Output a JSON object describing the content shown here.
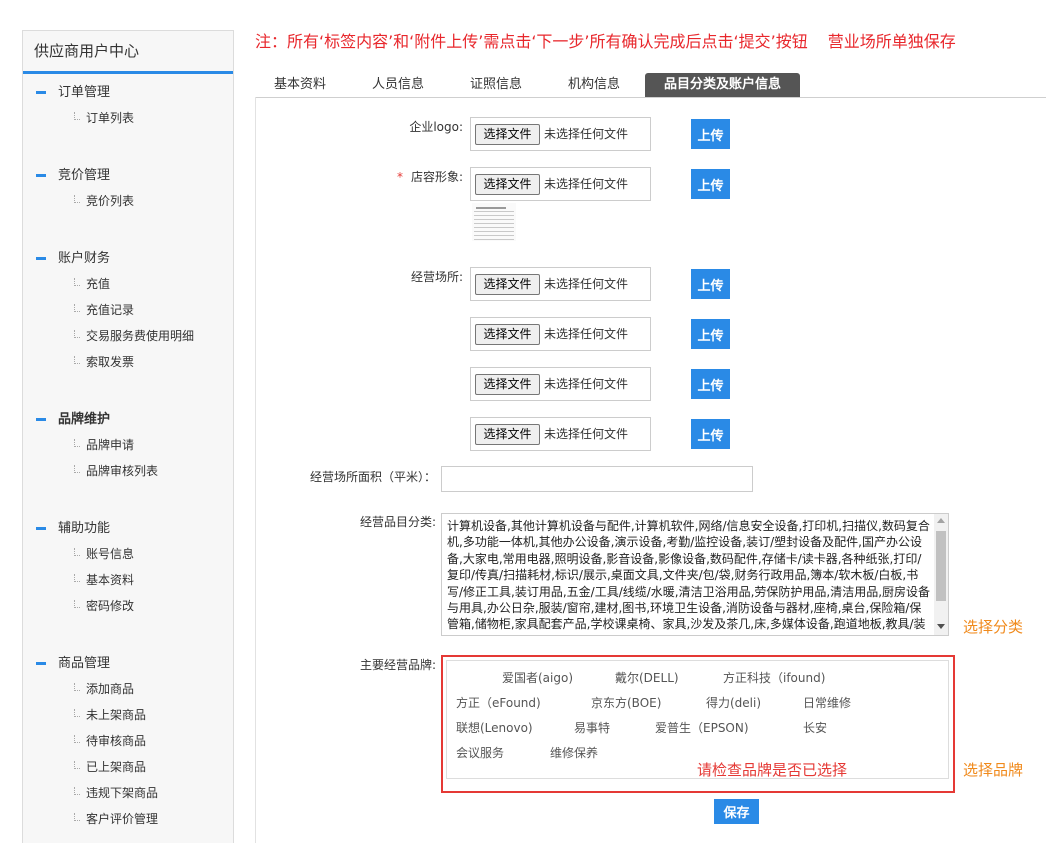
{
  "colors": {
    "accent": "#2a8ae6",
    "notice_red": "#e8272c",
    "hint_orange": "#f08a1c",
    "active_tab_bg": "#555555",
    "warning_red": "#e53935"
  },
  "sidebar": {
    "title": "供应商用户中心",
    "groups": [
      {
        "label": "订单管理",
        "emphasized": false,
        "items": [
          "订单列表"
        ]
      },
      {
        "label": "竞价管理",
        "emphasized": false,
        "items": [
          "竞价列表"
        ]
      },
      {
        "label": "账户财务",
        "emphasized": false,
        "items": [
          "充值",
          "充值记录",
          "交易服务费使用明细",
          "索取发票"
        ]
      },
      {
        "label": "品牌维护",
        "emphasized": true,
        "items": [
          "品牌申请",
          "品牌审核列表"
        ]
      },
      {
        "label": "辅助功能",
        "emphasized": false,
        "items": [
          "账号信息",
          "基本资料",
          "密码修改"
        ]
      },
      {
        "label": "商品管理",
        "emphasized": false,
        "items": [
          "添加商品",
          "未上架商品",
          "待审核商品",
          "已上架商品",
          "违规下架商品",
          "客户评价管理"
        ]
      }
    ]
  },
  "notice": {
    "main": "注：所有‘标签内容’和‘附件上传’需点击‘下一步’所有确认完成后点击‘提交’按钮",
    "extra": "营业场所单独保存"
  },
  "tabs": [
    {
      "label": "基本资料",
      "active": false
    },
    {
      "label": "人员信息",
      "active": false
    },
    {
      "label": "证照信息",
      "active": false
    },
    {
      "label": "机构信息",
      "active": false
    },
    {
      "label": "品目分类及账户信息",
      "active": true
    }
  ],
  "form": {
    "logo": {
      "label": "企业logo:",
      "file": {
        "button": "选择文件",
        "status": "未选择任何文件"
      },
      "upload": "上传"
    },
    "storefront": {
      "required_mark": "*",
      "label": "店容形象:",
      "file": {
        "button": "选择文件",
        "status": "未选择任何文件"
      },
      "upload": "上传"
    },
    "premises": {
      "label": "经营场所:",
      "files": [
        {
          "button": "选择文件",
          "status": "未选择任何文件",
          "upload": "上传"
        },
        {
          "button": "选择文件",
          "status": "未选择任何文件",
          "upload": "上传"
        },
        {
          "button": "选择文件",
          "status": "未选择任何文件",
          "upload": "上传"
        },
        {
          "button": "选择文件",
          "status": "未选择任何文件",
          "upload": "上传"
        }
      ]
    },
    "area": {
      "label": "经营场所面积（平米）：",
      "value": ""
    },
    "categories": {
      "label": "经营品目分类:",
      "value": "计算机设备,其他计算机设备与配件,计算机软件,网络/信息安全设备,打印机,扫描仪,数码复合机,多功能一体机,其他办公设备,演示设备,考勤/监控设备,装订/塑封设备及配件,国产办公设备,大家电,常用电器,照明设备,影音设备,影像设备,数码配件,存储卡/读卡器,各种纸张,打印/复印/传真/扫描耗材,标识/展示,桌面文具,文件夹/包/袋,财务行政用品,簿本/软木板/白板,书写/修正工具,装订用品,五金/工具/线缆/水暖,清洁卫浴用品,劳保防护用品,清洁用品,厨房设备与用具,办公日杂,服装/窗帘,建材,图书,环境卫生设备,消防设备与器材,座椅,桌台,保险箱/保管箱,储物柜,家具配套产品,学校课桌椅、家具,沙发及茶几,床,多媒体设备,跑道地板,教具/装具,",
      "hint": "选择分类"
    },
    "brands": {
      "label": "主要经营品牌:",
      "rows": [
        [
          "爱国者(aigo)",
          "戴尔(DELL)",
          "方正科技（ifound)"
        ],
        [
          "方正（eFound)",
          "京东方(BOE)",
          "得力(deli)",
          "日常维修"
        ],
        [
          "联想(Lenovo)",
          "易事特",
          "爱普生（EPSON)",
          "长安"
        ],
        [
          "会议服务",
          "维修保养"
        ]
      ],
      "warning": "请检查品牌是否已选择",
      "hint": "选择品牌"
    },
    "save_label": "保存"
  }
}
